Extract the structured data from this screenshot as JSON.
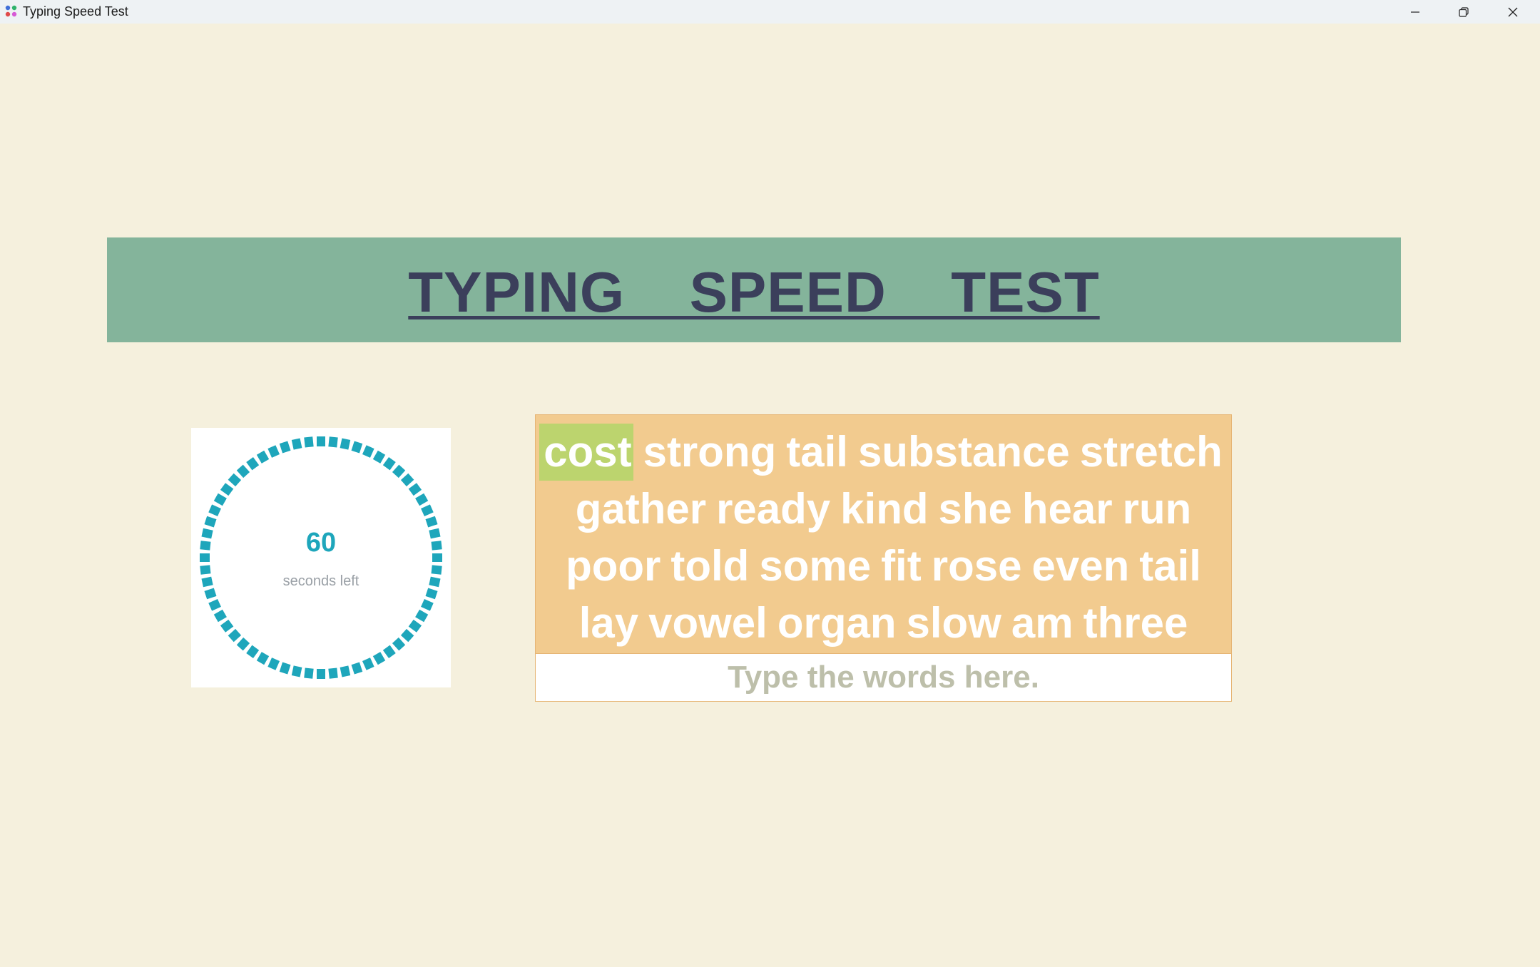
{
  "window": {
    "title": "Typing Speed Test"
  },
  "banner": {
    "title": "TYPING  SPEED  TEST"
  },
  "timer": {
    "value": "60",
    "label": "seconds left",
    "remaining_fraction": 1.0,
    "color": "#1ea6bb"
  },
  "words": {
    "current_index": 0,
    "lines": [
      [
        "cost",
        "strong",
        "tail",
        "substance",
        "stretch"
      ],
      [
        "gather",
        "ready",
        "kind",
        "she",
        "hear",
        "run"
      ],
      [
        "poor",
        "told",
        "some",
        "fit",
        "rose",
        "even",
        "tail"
      ],
      [
        "lay",
        "vowel",
        "organ",
        "slow",
        "am",
        "three"
      ]
    ],
    "highlight_color": "#bcd46e",
    "box_color": "#f2cb8f"
  },
  "input": {
    "value": "",
    "placeholder": "Type the words here."
  },
  "colors": {
    "background": "#f5f0dd",
    "banner": "#84b49b",
    "banner_text": "#3b3f5b"
  }
}
